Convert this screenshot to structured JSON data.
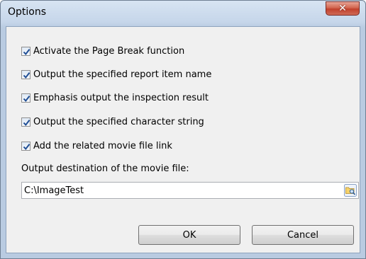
{
  "window": {
    "title": "Options",
    "close_icon": "close-icon"
  },
  "options": [
    {
      "label": "Activate the Page Break function",
      "checked": true
    },
    {
      "label": "Output the specified report item name",
      "checked": true
    },
    {
      "label": "Emphasis output the inspection result",
      "checked": true
    },
    {
      "label": "Output the specified character string",
      "checked": true
    },
    {
      "label": "Add the related movie file link",
      "checked": true
    }
  ],
  "movie_output": {
    "label": "Output destination of the movie file:",
    "value": "C:\\ImageTest",
    "browse_icon": "folder-browse-icon"
  },
  "buttons": {
    "ok_label": "OK",
    "cancel_label": "Cancel"
  },
  "colors": {
    "dialog_background": "#f0f0f0",
    "title_bar": "#c6d6ea",
    "close_button": "#c1412c"
  }
}
